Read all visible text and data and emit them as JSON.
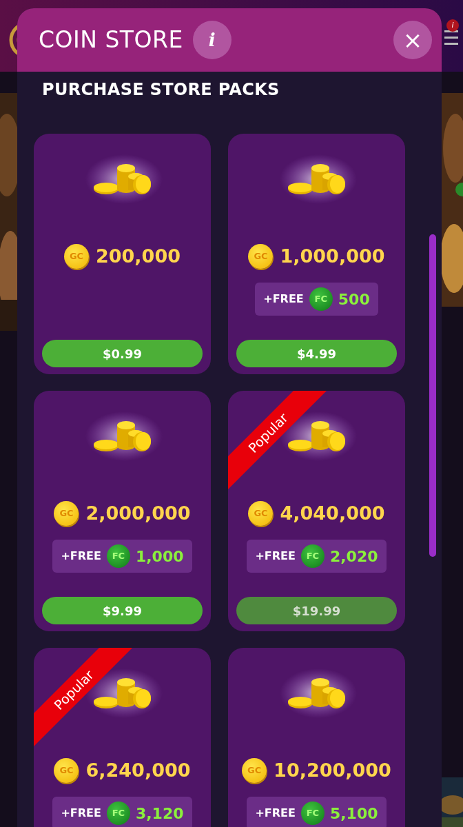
{
  "app_bar": {
    "menu_badge": "i"
  },
  "store": {
    "title": "COIN STORE",
    "info_label": "i",
    "close_label": "×"
  },
  "section_title": "PURCHASE STORE PACKS",
  "packs": [
    {
      "gold_label": "GC",
      "gold_amount": "200,000",
      "price": "$0.99",
      "pressed": false
    },
    {
      "gold_label": "GC",
      "gold_amount": "1,000,000",
      "free": {
        "label": "+FREE",
        "coin_label": "FC",
        "amount": "500"
      },
      "price": "$4.99",
      "pressed": false
    },
    {
      "gold_label": "GC",
      "gold_amount": "2,000,000",
      "free": {
        "label": "+FREE",
        "coin_label": "FC",
        "amount": "1,000"
      },
      "price": "$9.99",
      "pressed": false
    },
    {
      "ribbon": "Popular",
      "gold_label": "GC",
      "gold_amount": "4,040,000",
      "free": {
        "label": "+FREE",
        "coin_label": "FC",
        "amount": "2,020"
      },
      "price": "$19.99",
      "pressed": true
    },
    {
      "ribbon": "Popular",
      "gold_label": "GC",
      "gold_amount": "6,240,000",
      "free": {
        "label": "+FREE",
        "coin_label": "FC",
        "amount": "3,120"
      }
    },
    {
      "gold_label": "GC",
      "gold_amount": "10,200,000",
      "free": {
        "label": "+FREE",
        "coin_label": "FC",
        "amount": "5,100"
      }
    }
  ]
}
